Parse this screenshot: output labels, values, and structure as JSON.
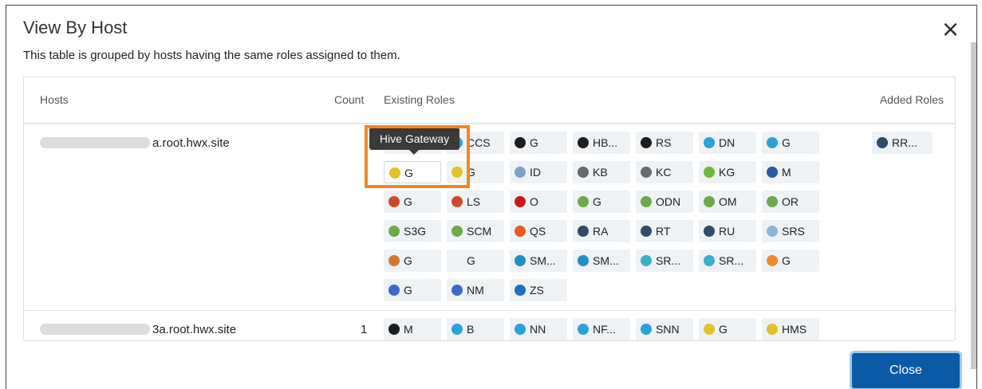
{
  "dialog": {
    "title": "View By Host",
    "subtitle": "This table is grouped by hosts having the same roles assigned to them.",
    "close_label": "Close",
    "close_icon": "×"
  },
  "table": {
    "columns": {
      "hosts": "Hosts",
      "count": "Count",
      "existing": "Existing Roles",
      "added": "Added Roles"
    },
    "rows": [
      {
        "host": "a.root.hwx.site",
        "count": "",
        "existing_roles": [
          [
            "",
            "CCS",
            "G",
            "HB...",
            "RS",
            "DN",
            "G"
          ],
          [
            "G",
            "G",
            "ID",
            "KB",
            "KC",
            "KG",
            "M"
          ],
          [
            "G",
            "LS",
            "O",
            "G",
            "ODN",
            "OM",
            "OR"
          ],
          [
            "S3G",
            "SCM",
            "QS",
            "RA",
            "RT",
            "RU",
            "SRS"
          ],
          [
            "G",
            "G",
            "SM...",
            "SM...",
            "SR...",
            "SR...",
            "G"
          ],
          [
            "G",
            "NM",
            "ZS"
          ]
        ],
        "added_roles": [
          "RR..."
        ]
      },
      {
        "host": "3a.root.hwx.site",
        "count": "1",
        "existing_roles": [
          [
            "M",
            "B",
            "NN",
            "NF...",
            "SNN",
            "G",
            "HMS"
          ]
        ],
        "added_roles": []
      }
    ]
  },
  "tooltip": {
    "text": "Hive Gateway"
  },
  "colors": {
    "primary_button": "#0a5aa8",
    "highlight": "#f0881f",
    "chip_bg": "#eef2f4"
  }
}
